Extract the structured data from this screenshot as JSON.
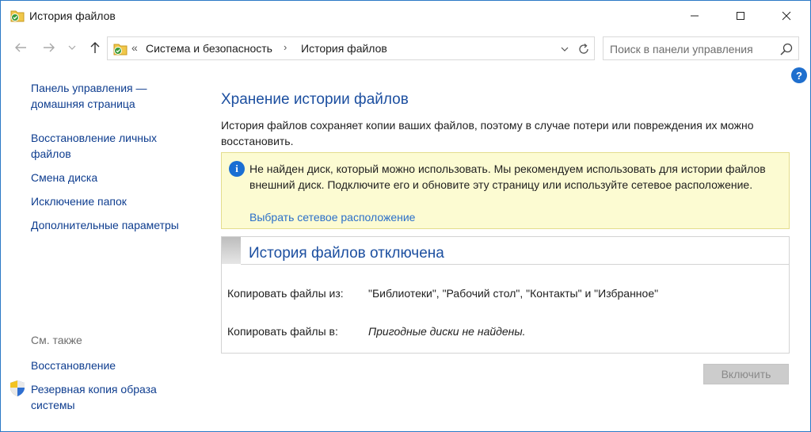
{
  "window": {
    "title": "История файлов"
  },
  "address_bar": {
    "overflow_chevron": "«",
    "breadcrumbs": [
      {
        "label": "Система и безопасность"
      },
      {
        "label": "История файлов"
      }
    ],
    "separator": "›"
  },
  "search": {
    "placeholder": "Поиск в панели управления"
  },
  "help": {
    "label": "?"
  },
  "sidebar": {
    "home_link": "Панель управления — домашняя страница",
    "links": [
      "Восстановление личных файлов",
      "Смена диска",
      "Исключение папок",
      "Дополнительные параметры"
    ],
    "see_also_label": "См. также",
    "see_also_links": [
      "Восстановление",
      "Резервная копия образа системы"
    ]
  },
  "main": {
    "heading": "Хранение истории файлов",
    "description": "История файлов сохраняет копии ваших файлов, поэтому в случае потери или повреждения их можно восстановить.",
    "notice": {
      "icon_text": "i",
      "text": "Не найден диск, который можно использовать. Мы рекомендуем использовать для истории файлов внешний диск. Подключите его и обновите эту страницу или используйте сетевое расположение.",
      "link": "Выбрать сетевое расположение"
    },
    "status": {
      "title": "История файлов отключена",
      "rows": [
        {
          "label": "Копировать файлы из:",
          "value": "\"Библиотеки\", \"Рабочий стол\", \"Контакты\" и \"Избранное\""
        },
        {
          "label": "Копировать файлы в:",
          "value": "Пригодные диски не найдены."
        }
      ]
    },
    "enable_button": "Включить"
  },
  "colors": {
    "accent_heading": "#1c4fa0",
    "link": "#0e3d8f",
    "notice_bg": "#fcfbd2",
    "notice_border": "#e3dd8d",
    "info_icon": "#1a6fd3",
    "disabled_button": "#cccccc"
  }
}
